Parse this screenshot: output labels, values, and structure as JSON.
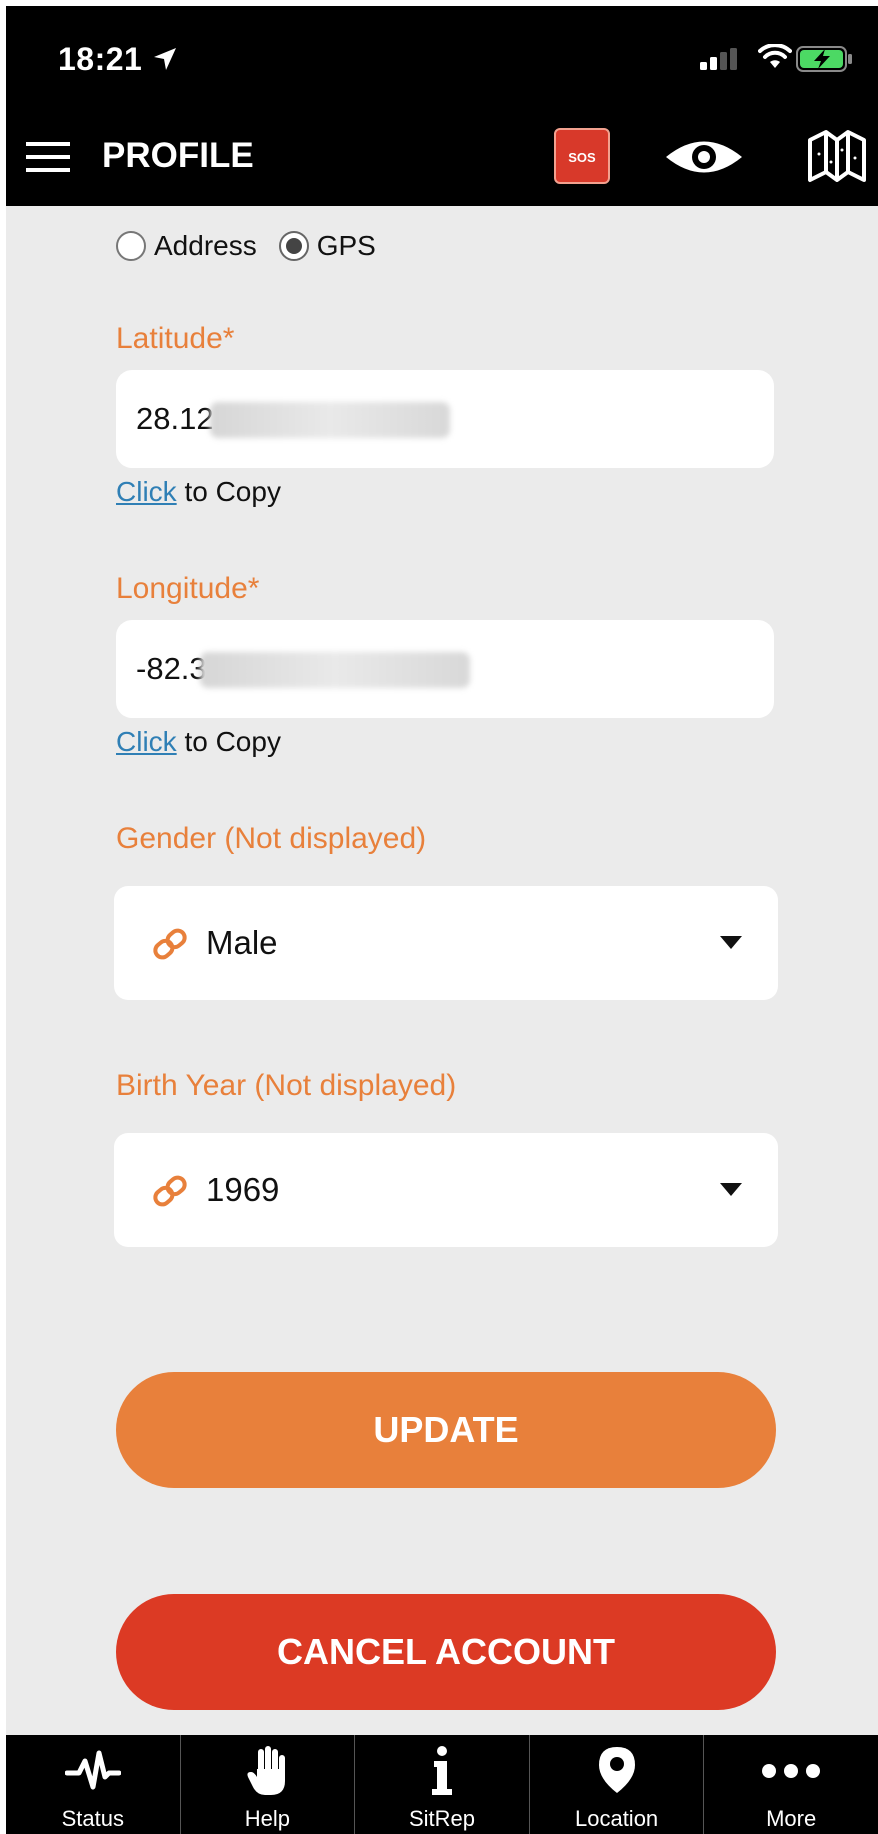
{
  "status_bar": {
    "time": "18:21"
  },
  "header": {
    "title": "PROFILE",
    "sos_label": "SOS"
  },
  "location_mode": {
    "options": [
      {
        "label": "Address",
        "selected": false
      },
      {
        "label": "GPS",
        "selected": true
      }
    ]
  },
  "latitude": {
    "label": "Latitude*",
    "value": "28.12",
    "copy_link": "Click",
    "copy_suffix": " to Copy"
  },
  "longitude": {
    "label": "Longitude*",
    "value": "-82.3",
    "copy_link": "Click",
    "copy_suffix": " to Copy"
  },
  "gender": {
    "label": "Gender (Not displayed)",
    "value": "Male",
    "icon": "link-icon"
  },
  "birth_year": {
    "label": "Birth Year (Not displayed)",
    "value": "1969",
    "icon": "link-icon"
  },
  "buttons": {
    "update": "UPDATE",
    "cancel_account": "CANCEL ACCOUNT"
  },
  "tabs": [
    {
      "label": "Status",
      "icon": "heartbeat-icon"
    },
    {
      "label": "Help",
      "icon": "hand-icon"
    },
    {
      "label": "SitRep",
      "icon": "info-icon"
    },
    {
      "label": "Location",
      "icon": "map-pin-icon"
    },
    {
      "label": "More",
      "icon": "more-dots-icon"
    }
  ],
  "colors": {
    "accent_orange": "#e8803b",
    "danger_red": "#dc3a24",
    "link_blue": "#2f7fb5",
    "background": "#ebebeb"
  }
}
